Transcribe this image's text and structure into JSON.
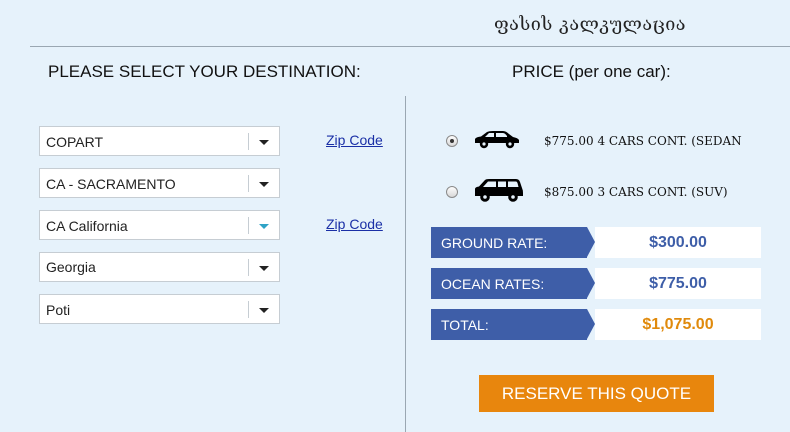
{
  "header": {
    "title": "ფასის კალკულაცია"
  },
  "left": {
    "heading": "PLEASE SELECT YOUR DESTINATION:",
    "selects": [
      {
        "value": "COPART"
      },
      {
        "value": "CA - SACRAMENTO"
      },
      {
        "value": "CA California"
      },
      {
        "value": "Georgia"
      },
      {
        "value": "Poti"
      }
    ],
    "zip_links": [
      "Zip Code",
      "Zip Code"
    ]
  },
  "right": {
    "heading": "PRICE (per one car):",
    "options": [
      {
        "label": "$775.00  4 CARS CONT. (SEDAN",
        "checked": true,
        "icon": "sedan-icon"
      },
      {
        "label": "$875.00  3 CARS CONT. (SUV)",
        "checked": false,
        "icon": "suv-icon"
      }
    ],
    "rates": [
      {
        "label": "GROUND RATE:",
        "amount": "$300.00"
      },
      {
        "label": "OCEAN RATES:",
        "amount": "$775.00"
      },
      {
        "label": "TOTAL:",
        "amount": "$1,075.00"
      }
    ],
    "reserve_label": "RESERVE THIS QUOTE"
  },
  "colors": {
    "background": "#e6f2fb",
    "rate_tag": "#3e5ea8",
    "total_amount": "#e08a0c",
    "reserve_button": "#e8860d",
    "link": "#1a2fa6"
  }
}
